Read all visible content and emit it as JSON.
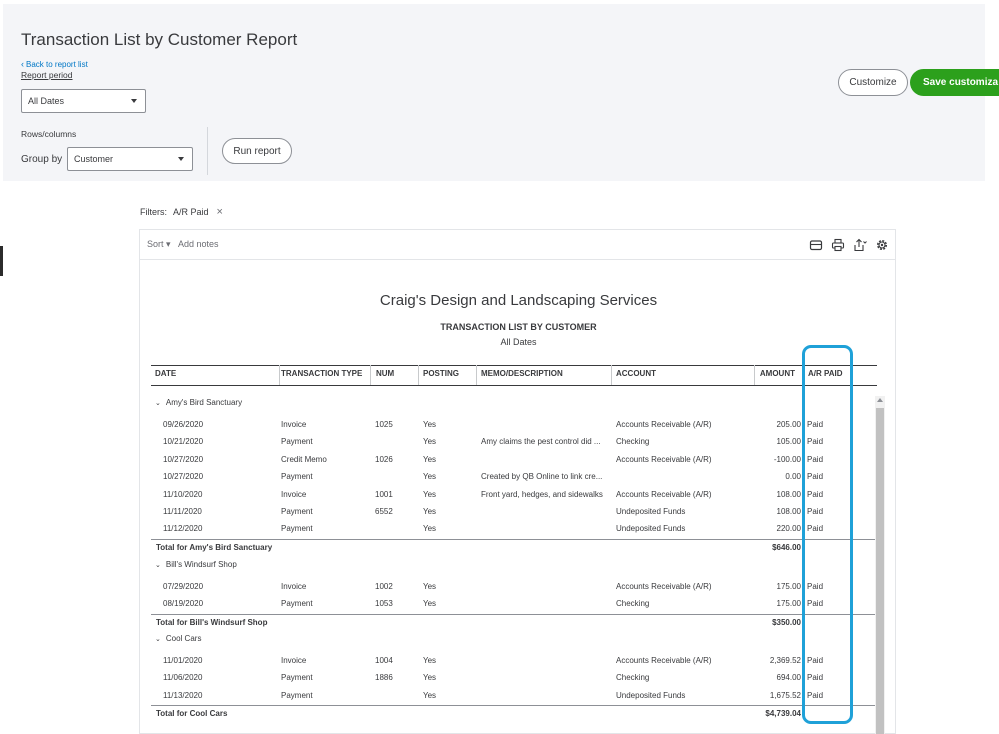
{
  "page": {
    "title": "Transaction List by Customer Report",
    "back_link": "Back to report list",
    "report_period_label": "Report period",
    "report_period_value": "All Dates",
    "rows_columns_label": "Rows/columns",
    "group_by_label": "Group by",
    "group_by_value": "Customer",
    "run_report": "Run report",
    "customize": "Customize",
    "save_customization": "Save customiza"
  },
  "filters": {
    "label": "Filters:",
    "chip": "A/R Paid",
    "chip_close": "×"
  },
  "toolbar": {
    "sort": "Sort ▾",
    "add_notes": "Add notes",
    "icons": [
      "email-icon",
      "print-icon",
      "export-icon",
      "settings-icon"
    ]
  },
  "report": {
    "company": "Craig's Design and Landscaping Services",
    "title": "TRANSACTION LIST BY CUSTOMER",
    "subtitle": "All Dates",
    "columns": [
      "DATE",
      "TRANSACTION TYPE",
      "NUM",
      "POSTING",
      "MEMO/DESCRIPTION",
      "ACCOUNT",
      "AMOUNT",
      "A/R PAID"
    ],
    "groups": [
      {
        "name": "Amy's Bird Sanctuary",
        "rows": [
          [
            "09/26/2020",
            "Invoice",
            "1025",
            "Yes",
            "",
            "Accounts Receivable (A/R)",
            "205.00",
            "Paid"
          ],
          [
            "10/21/2020",
            "Payment",
            "",
            "Yes",
            "Amy claims the pest control did ...",
            "Checking",
            "105.00",
            "Paid"
          ],
          [
            "10/27/2020",
            "Credit Memo",
            "1026",
            "Yes",
            "",
            "Accounts Receivable (A/R)",
            "-100.00",
            "Paid"
          ],
          [
            "10/27/2020",
            "Payment",
            "",
            "Yes",
            "Created by QB Online to link cre...",
            "",
            "0.00",
            "Paid"
          ],
          [
            "11/10/2020",
            "Invoice",
            "1001",
            "Yes",
            "Front yard, hedges, and sidewalks",
            "Accounts Receivable (A/R)",
            "108.00",
            "Paid"
          ],
          [
            "11/11/2020",
            "Payment",
            "6552",
            "Yes",
            "",
            "Undeposited Funds",
            "108.00",
            "Paid"
          ],
          [
            "11/12/2020",
            "Payment",
            "",
            "Yes",
            "",
            "Undeposited Funds",
            "220.00",
            "Paid"
          ]
        ],
        "total_label": "Total for Amy's Bird Sanctuary",
        "total": "$646.00"
      },
      {
        "name": "Bill's Windsurf Shop",
        "rows": [
          [
            "07/29/2020",
            "Invoice",
            "1002",
            "Yes",
            "",
            "Accounts Receivable (A/R)",
            "175.00",
            "Paid"
          ],
          [
            "08/19/2020",
            "Payment",
            "1053",
            "Yes",
            "",
            "Checking",
            "175.00",
            "Paid"
          ]
        ],
        "total_label": "Total for Bill's Windsurf Shop",
        "total": "$350.00"
      },
      {
        "name": "Cool Cars",
        "rows": [
          [
            "11/01/2020",
            "Invoice",
            "1004",
            "Yes",
            "",
            "Accounts Receivable (A/R)",
            "2,369.52",
            "Paid"
          ],
          [
            "11/06/2020",
            "Payment",
            "1886",
            "Yes",
            "",
            "Checking",
            "694.00",
            "Paid"
          ],
          [
            "11/13/2020",
            "Payment",
            "",
            "Yes",
            "",
            "Undeposited Funds",
            "1,675.52",
            "Paid"
          ]
        ],
        "total_label": "Total for Cool Cars",
        "total": "$4,739.04"
      }
    ]
  },
  "colors": {
    "accent_green": "#2ca01c",
    "link_blue": "#0077c5",
    "highlight": "#1fa1d8",
    "panel": "#f4f5f8"
  }
}
